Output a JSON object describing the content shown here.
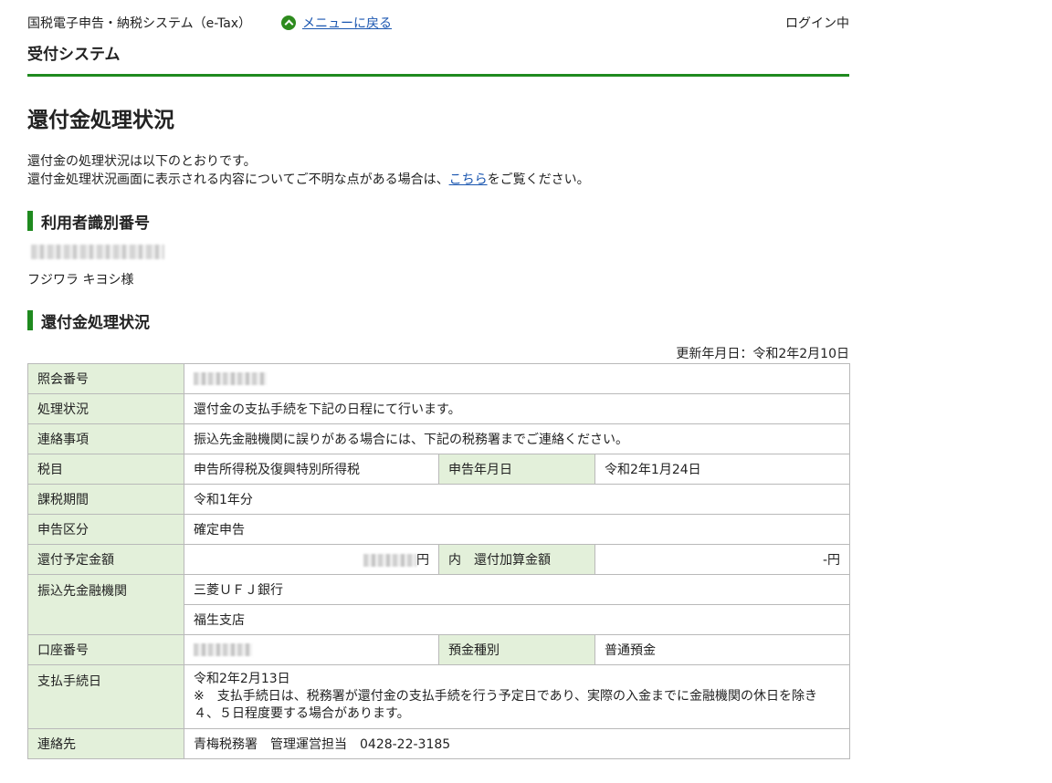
{
  "header": {
    "system_name": "国税電子申告・納税システム（e-Tax）",
    "menu_link": "メニューに戻る",
    "login_status": "ログイン中",
    "subsystem": "受付システム"
  },
  "page": {
    "title": "還付金処理状況",
    "intro_line1": "還付金の処理状況は以下のとおりです。",
    "intro_line2_pre": "還付金処理状況画面に表示される内容についてご不明な点がある場合は、",
    "intro_link": "こちら",
    "intro_line2_post": "をご覧ください。"
  },
  "user_section": {
    "heading": "利用者識別番号",
    "name": "フジワラ キヨシ様"
  },
  "status_section": {
    "heading": "還付金処理状況",
    "updated": "更新年月日：令和2年2月10日"
  },
  "table": {
    "inquiry_no_label": "照会番号",
    "status_label": "処理状況",
    "status_value": "還付金の支払手続を下記の日程にて行います。",
    "contact_note_label": "連絡事項",
    "contact_note_value": "振込先金融機関に誤りがある場合には、下記の税務署までご連絡ください。",
    "tax_item_label": "税目",
    "tax_item_value": "申告所得税及復興特別所得税",
    "filing_date_label": "申告年月日",
    "filing_date_value": "令和2年1月24日",
    "period_label": "課税期間",
    "period_value": "令和1年分",
    "filing_type_label": "申告区分",
    "filing_type_value": "確定申告",
    "refund_amount_label": "還付予定金額",
    "yen": "円",
    "addition_label": "内　還付加算金額",
    "addition_value": "-円",
    "bank_label": "振込先金融機関",
    "bank_name": "三菱ＵＦＪ銀行",
    "branch_name": "福生支店",
    "account_no_label": "口座番号",
    "deposit_type_label": "預金種別",
    "deposit_type_value": "普通預金",
    "payment_date_label": "支払手続日",
    "payment_date_value": "令和2年2月13日",
    "payment_note": "※　支払手続日は、税務署が還付金の支払手続を行う予定日であり、実際の入金までに金融機関の休日を除き４、５日程度要する場合があります。",
    "contact_label": "連絡先",
    "contact_value": "青梅税務署　管理運営担当　0428-22-3185"
  },
  "colors": {
    "accent_green": "#1f8a1f",
    "header_cell_bg": "#e3f0da",
    "link_blue": "#1a56b0"
  },
  "icons": {
    "menu_icon": "chevron-up-circle-icon"
  }
}
